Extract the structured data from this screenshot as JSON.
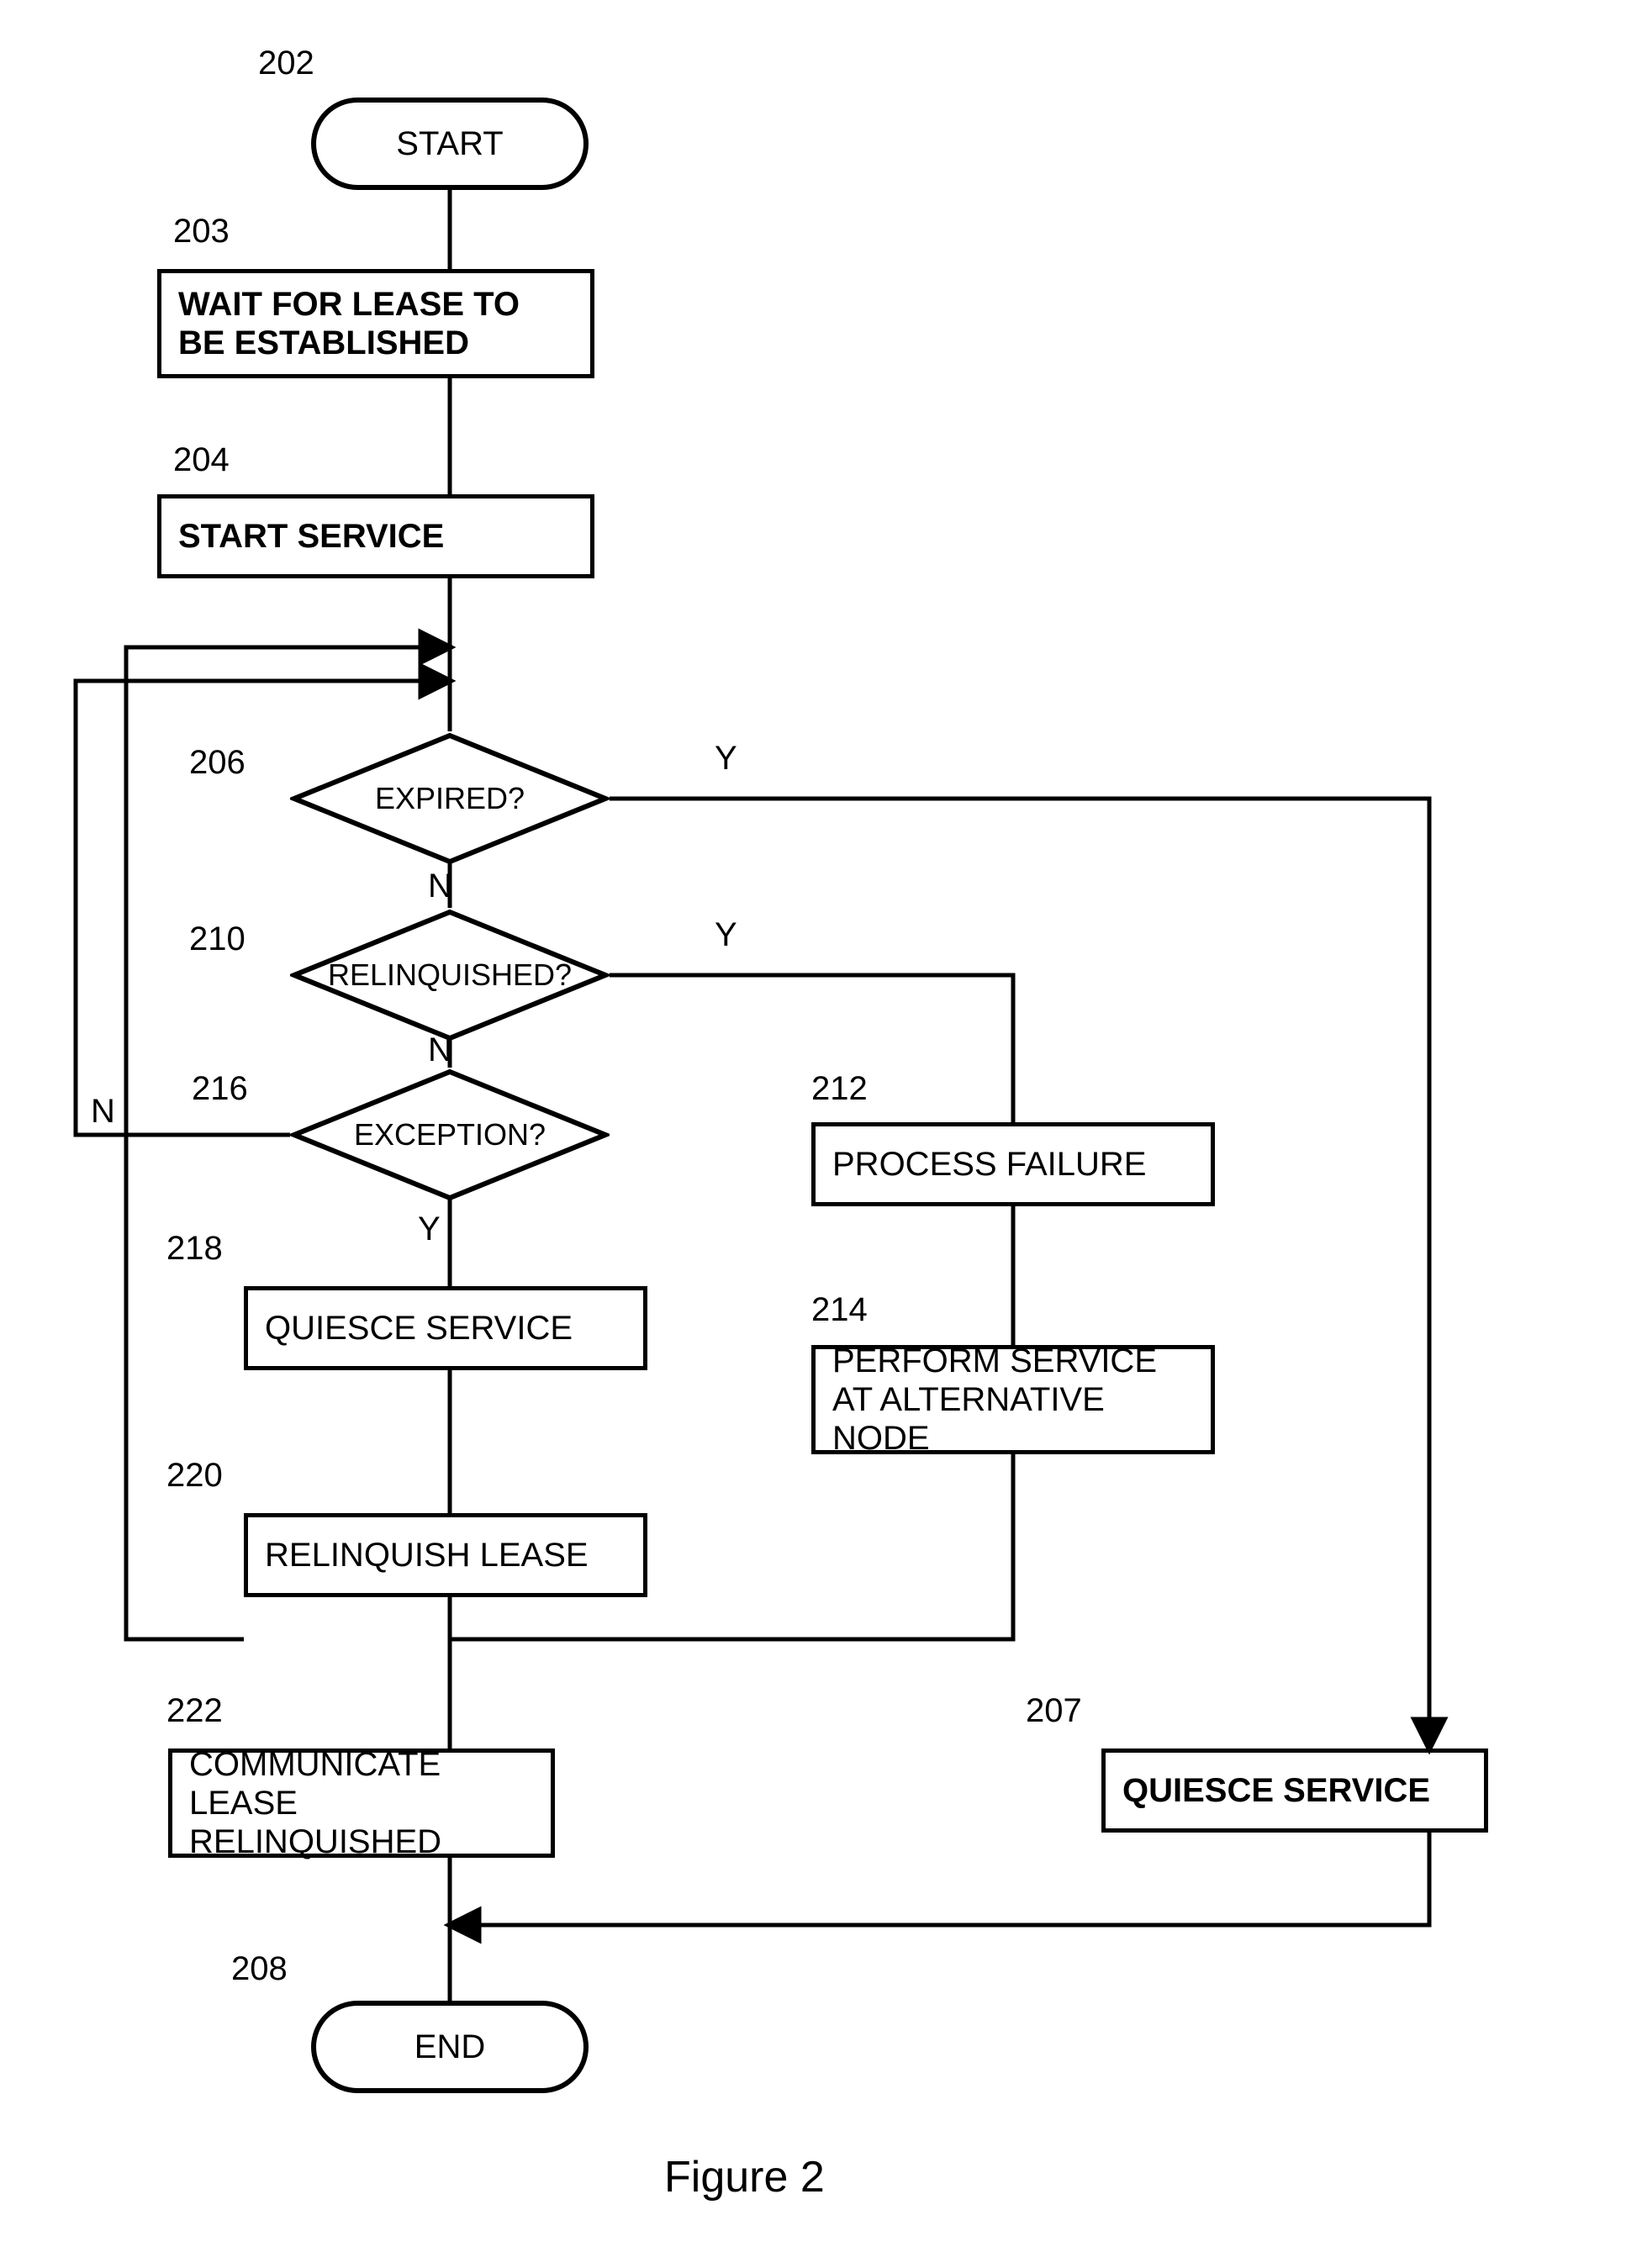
{
  "caption": "Figure 2",
  "labels": {
    "n202": "202",
    "n203": "203",
    "n204": "204",
    "n206": "206",
    "n207": "207",
    "n208": "208",
    "n210": "210",
    "n212": "212",
    "n214": "214",
    "n216": "216",
    "n218": "218",
    "n220": "220",
    "n222": "222"
  },
  "text": {
    "start": "START",
    "wait": "WAIT FOR LEASE TO BE ESTABLISHED",
    "startService": "START SERVICE",
    "expired": "EXPIRED?",
    "relinquished": "RELINQUISHED?",
    "exception": "EXCEPTION?",
    "processFailure": "PROCESS FAILURE",
    "performAlt": "PERFORM SERVICE AT ALTERNATIVE NODE",
    "quiesce218": "QUIESCE SERVICE",
    "relinquishLease": "RELINQUISH LEASE",
    "communicate": "COMMUNICATE LEASE RELINQUISHED",
    "quiesce207": "QUIESCE SERVICE",
    "end": "END"
  },
  "yn": {
    "Y": "Y",
    "N": "N"
  }
}
